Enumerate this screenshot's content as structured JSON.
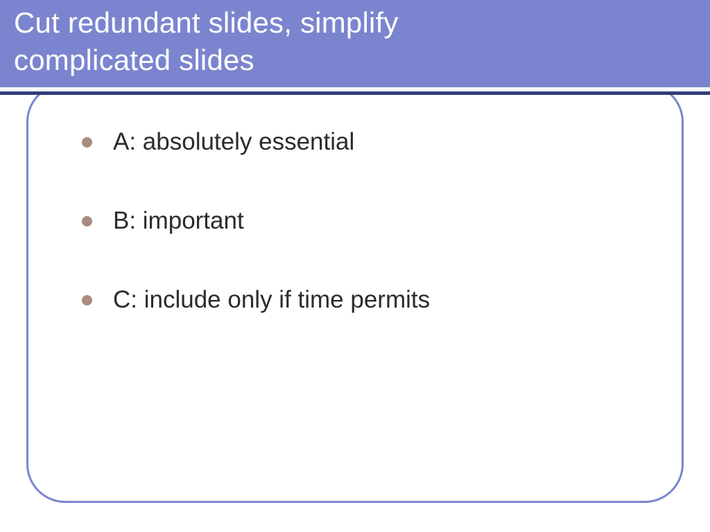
{
  "title": {
    "line1": "Cut redundant slides, simplify",
    "line2": "complicated slides"
  },
  "bullets": [
    "A: absolutely essential",
    "B: important",
    "C: include only if time permits"
  ],
  "colors": {
    "band": "#7B85CF",
    "rule": "#333B7C",
    "bullet": "#A98C7F",
    "text": "#2b2b2b"
  }
}
